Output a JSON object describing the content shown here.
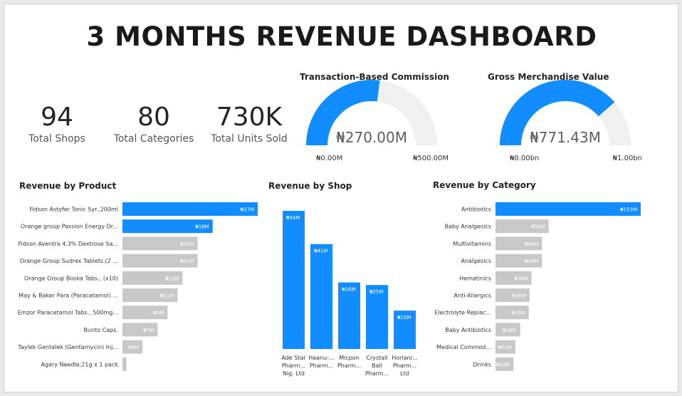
{
  "title": "3 MONTHS REVENUE DASHBOARD",
  "colors": {
    "accent": "#118DFF",
    "muted": "#C8C8C8",
    "track": "#F0F0F0"
  },
  "kpis": [
    {
      "value": "94",
      "label": "Total Shops"
    },
    {
      "value": "80",
      "label": "Total Categories"
    },
    {
      "value": "730K",
      "label": "Total Units Sold"
    }
  ],
  "gauges": [
    {
      "title": "Transaction-Based Commission",
      "value": 270,
      "max": 500,
      "value_label": "₦270.00M",
      "min_label": "₦0.00M",
      "max_label": "₦500.00M"
    },
    {
      "title": "Gross Merchandise Value",
      "value": 0.77143,
      "max": 1.0,
      "value_label": "₦771.43M",
      "min_label": "₦0.00bn",
      "max_label": "₦1.00bn"
    }
  ],
  "chart_data": [
    {
      "type": "bar",
      "orientation": "horizontal",
      "title": "Revenue by Product",
      "categories": [
        "Fidson Astyfer Tonic Syr.,200ml",
        "Orange group Passion Energy Dr...",
        "Fidson Aventra 4.3% Dextrose Sa...",
        "Orange Group Sudrex Tablets.(2 ...",
        "Orange Group Boska Tabs., (x10)",
        "May & Baker Para (Paracetamol) ...",
        "Emzor Paracetamol Tabs., 500mg...",
        "Bunto Caps.",
        "Taylek Gentalek (Gentamycin) Inj...",
        "Agary Needle;21g x 1 pack"
      ],
      "values": [
        27,
        18,
        15,
        15,
        12,
        11,
        9,
        7,
        4,
        0.8
      ],
      "data_labels": [
        "₦27M",
        "₦18M",
        "₦15M",
        "₦15M",
        "₦12M",
        "₦11M",
        "₦9M",
        "₦7M",
        "₦4M",
        ""
      ],
      "highlight_count": 2
    },
    {
      "type": "bar",
      "orientation": "vertical",
      "title": "Revenue by Shop",
      "categories": [
        [
          "Ade Star",
          "Pharm...",
          "Nig. Ltd"
        ],
        [
          "Haanu-...",
          "Pharm..."
        ],
        [
          "Micpon",
          "Pharm..."
        ],
        [
          "Crystall",
          "Ball",
          "Pharm..."
        ],
        [
          "Horlanr...",
          "Pharm...",
          "Ltd"
        ]
      ],
      "values": [
        54,
        41,
        26,
        25,
        15
      ],
      "data_labels": [
        "₦54M",
        "₦41M",
        "₦26M",
        "₦25M",
        "₦15M"
      ]
    },
    {
      "type": "bar",
      "orientation": "horizontal",
      "title": "Revenue by Category",
      "categories": [
        "Antibiotics",
        "Baby Analgesics",
        "Multivitamins",
        "Analgesics",
        "Hematinics",
        "Anti-Allergics",
        "Electrolyte Replac...",
        "Baby Antibiotics",
        "Medical Commod...",
        "Drinks"
      ],
      "values": [
        153,
        56,
        49,
        49,
        38,
        36,
        35,
        26,
        21,
        19
      ],
      "data_labels": [
        "₦153M",
        "₦56M",
        "₦49M",
        "₦49M",
        "₦38M",
        "₦36M",
        "₦35M",
        "₦26M",
        "₦21M",
        "₦19M"
      ],
      "highlight_count": 1
    }
  ]
}
